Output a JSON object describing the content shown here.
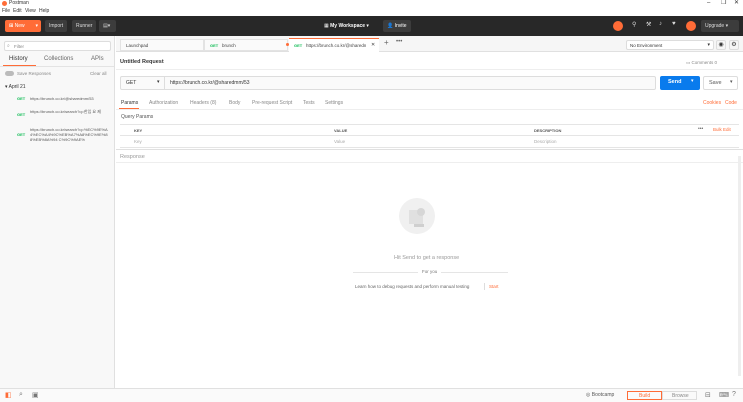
{
  "app": {
    "title": "Postman"
  },
  "menu": [
    "File",
    "Edit",
    "View",
    "Help"
  ],
  "window_controls": [
    "minimize",
    "maximize",
    "close"
  ],
  "header": {
    "new_label": "New",
    "import_label": "Import",
    "runner_label": "Runner",
    "workspace_label": "My Workspace",
    "invite_label": "Invite",
    "upgrade_label": "Upgrade"
  },
  "sidebar": {
    "filter_placeholder": "Filter",
    "tabs": [
      "History",
      "Collections",
      "APIs"
    ],
    "save_responses_label": "Save Responses",
    "clear_all_label": "Clear all",
    "group_label": "April 21",
    "items": [
      {
        "method": "GET",
        "url": "https://brunch.co.kr/@sharedmm/53"
      },
      {
        "method": "GET",
        "url": "https://brunch.co.kr/search?q=한입 요 제"
      },
      {
        "method": "GET",
        "url": "https://brunch.co.kr/search?q=%EC%9E%A4%EC%A4%9C%EB%A7%A8%EC%9E%88%EB%8A%94 C%9C%9AE%"
      }
    ]
  },
  "tabs": [
    {
      "label": "Launchpad",
      "method": ""
    },
    {
      "label": "brunch",
      "method": "GET"
    },
    {
      "label": "https://brunch.co.kr/@sharedm",
      "method": "GET"
    }
  ],
  "environment": {
    "selected": "No Environment"
  },
  "request": {
    "title": "Untitled Request",
    "comments_label": "Comments",
    "comments_count": "0",
    "method": "GET",
    "url": "https://brunch.co.kr/@sharedmm/53",
    "send_label": "Send",
    "save_label": "Save",
    "subtabs": [
      "Params",
      "Authorization",
      "Headers (8)",
      "Body",
      "Pre-request Script",
      "Tests",
      "Settings"
    ],
    "cookies_label": "Cookies",
    "code_label": "Code",
    "query_params_label": "Query Params",
    "table_headers": {
      "key": "KEY",
      "value": "VALUE",
      "description": "DESCRIPTION"
    },
    "bulk_edit_label": "Bulk Edit",
    "placeholder_row": {
      "key": "Key",
      "value": "Value",
      "description": "Description"
    }
  },
  "response": {
    "label": "Response",
    "hint": "Hit Send to get a response",
    "for_you": "For you",
    "learn_text": "Learn how to debug requests and perform manual testing",
    "start_label": "Start"
  },
  "statusbar": {
    "bootcamp_label": "Bootcamp",
    "build_label": "Build",
    "browse_label": "Browse"
  },
  "colors": {
    "accent": "#ff6c37",
    "send": "#097bed",
    "header_bg": "#282828",
    "get": "#0cbb52"
  }
}
